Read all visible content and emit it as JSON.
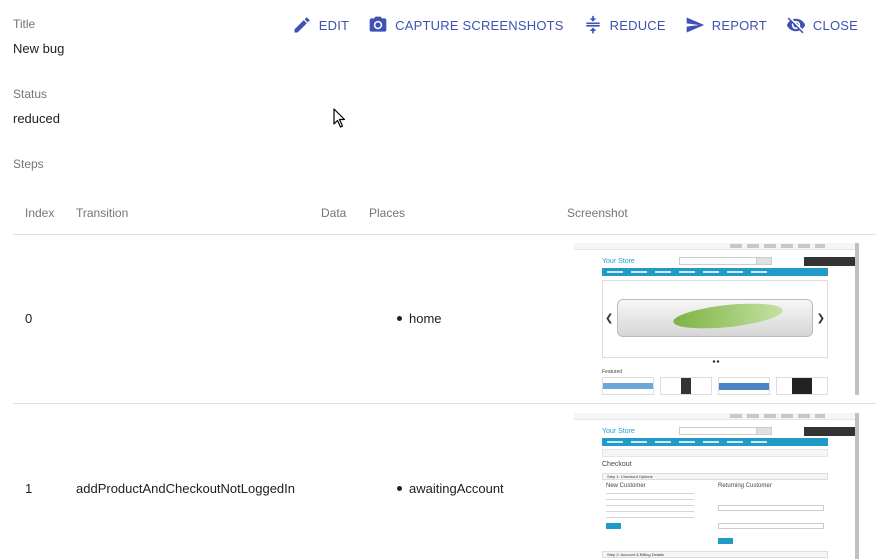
{
  "title": {
    "label": "Title",
    "value": "New bug"
  },
  "status": {
    "label": "Status",
    "value": "reduced"
  },
  "steps_label": "Steps",
  "toolbar": {
    "edit": "EDIT",
    "capture": "CAPTURE SCREENSHOTS",
    "reduce": "REDUCE",
    "report": "REPORT",
    "close": "CLOSE"
  },
  "table": {
    "headers": [
      "Index",
      "Transition",
      "Data",
      "Places",
      "Screenshot"
    ],
    "rows": [
      {
        "index": "0",
        "transition": "",
        "data": "",
        "places": [
          "home"
        ]
      },
      {
        "index": "1",
        "transition": "addProductAndCheckoutNotLoggedIn",
        "data": "",
        "places": [
          "awaitingAccount"
        ]
      }
    ]
  },
  "thumb_home": {
    "store": "Your Store",
    "featured": "Featured"
  },
  "thumb_checkout": {
    "store": "Your Store",
    "heading": "Checkout",
    "step1": "Step 1: Checkout Options",
    "new_customer": "New Customer",
    "returning_customer": "Returning Customer",
    "step2": "Step 2: Account & Billing Details"
  },
  "colors": {
    "accent": "#3f51b5",
    "store_blue": "#229ac8"
  }
}
